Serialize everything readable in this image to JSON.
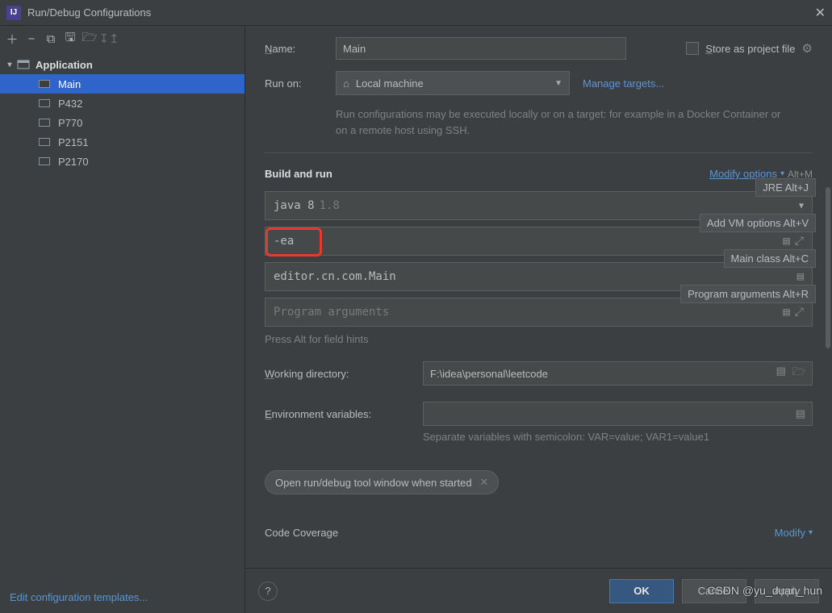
{
  "window": {
    "title": "Run/Debug Configurations"
  },
  "tree": {
    "root": "Application",
    "items": [
      {
        "label": "Main",
        "selected": true
      },
      {
        "label": "P432"
      },
      {
        "label": "P770"
      },
      {
        "label": "P2151"
      },
      {
        "label": "P2170"
      }
    ]
  },
  "edit_templates": "Edit configuration templates...",
  "form": {
    "name_label": "Name:",
    "name_value": "Main",
    "store": "Store as project file",
    "runon_label": "Run on:",
    "runon_value": "Local machine",
    "manage_targets": "Manage targets...",
    "runon_help": "Run configurations may be executed locally or on a target: for example in a Docker Container or on a remote host using SSH."
  },
  "build": {
    "section": "Build and run",
    "modify_options": "Modify options",
    "modify_kbd": "Alt+M",
    "java_label": "java 8",
    "java_ver": "1.8",
    "vm_options_value": "-ea",
    "main_class_value": "editor.cn.com.Main",
    "program_args_placeholder": "Program arguments",
    "hints": {
      "jre": "JRE Alt+J",
      "vm": "Add VM options Alt+V",
      "main": "Main class Alt+C",
      "args": "Program arguments Alt+R"
    },
    "field_hint": "Press Alt for field hints"
  },
  "wd": {
    "label": "Working directory:",
    "value": "F:\\idea\\personal\\leetcode"
  },
  "env": {
    "label": "Environment variables:",
    "value": "",
    "hint": "Separate variables with semicolon: VAR=value; VAR1=value1"
  },
  "chip": "Open run/debug tool window when started",
  "coverage": {
    "title": "Code Coverage",
    "modify": "Modify"
  },
  "footer": {
    "ok": "OK",
    "cancel": "Cancel",
    "apply": "Apply"
  },
  "watermark": "CSDN @yu_duan_hun"
}
